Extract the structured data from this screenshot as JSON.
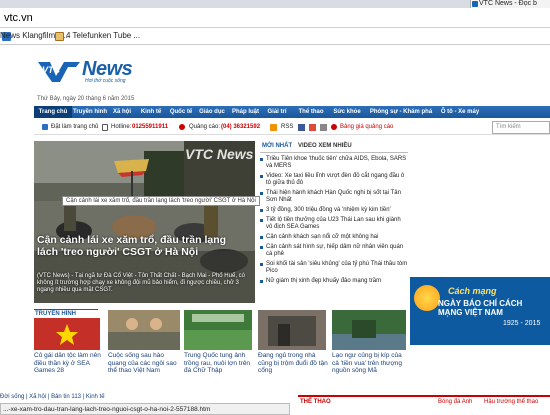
{
  "browser": {
    "tab_title": "VTC News - Đọc b",
    "url": "vtc.vn",
    "bookmarks": [
      {
        "label": "News Klangfilm T..."
      },
      {
        "label": "4 Telefunken Tube ..."
      }
    ]
  },
  "site": {
    "logo": "News",
    "logo_brand": "VTC",
    "tagline": "Hơi thở cuộc sống",
    "date": "Thứ Bảy, ngày 20 tháng 6 năm 2015"
  },
  "nav": {
    "items": [
      {
        "label": "Trang chủ",
        "active": true
      },
      {
        "label": "Truyền hình",
        "active": false
      },
      {
        "label": "Xã hội",
        "active": false
      },
      {
        "label": "Kinh tế",
        "active": false
      },
      {
        "label": "Quốc tế",
        "active": false
      },
      {
        "label": "Giáo dục",
        "active": false
      },
      {
        "label": "Pháp luật",
        "active": false
      },
      {
        "label": "Giải trí",
        "active": false
      },
      {
        "label": "Thể thao",
        "active": false
      },
      {
        "label": "Sức khỏe",
        "active": false
      },
      {
        "label": "Phóng sự - Khám phá",
        "active": false
      },
      {
        "label": "Ô tô - Xe máy",
        "active": false
      }
    ]
  },
  "infobar": {
    "fixed_label": "Đặt làm trang chủ",
    "hotline_label": "Hotline:",
    "hotline": "01255911911",
    "ads_label": "Quảng cáo:",
    "ads_phone": "(04) 36321592",
    "rss": "RSS",
    "price_link": "Bảng giá quảng cáo",
    "search_placeholder": "Tìm kiếm"
  },
  "hero": {
    "image_watermark": "VTC News",
    "tooltip": "Cận cảnh lái xe xăm trổ, đầu trần lạng lách 'treo người' CSGT ở Hà Nội",
    "title": "Cận cảnh lái xe xăm trổ, đầu trần lạng lách 'treo người' CSGT ở Hà Nội",
    "desc": "(VTC News) - Tại ngã tư Đà Cổ Việt - Tôn Thất Chất - Bạch Mai - Phố Huế, có không ít trường hợp chạy xe không đội mũ bảo hiểm, đi ngược chiều, chở 3 ngang nhiều qua mặt CSGT."
  },
  "news": {
    "tab_latest": "MỚI NHẤT",
    "tab_video": "VIDEO XEM NHIỀU",
    "items": [
      "Triều Tiên khoe 'thuốc tiên' chữa AIDS, Ebola, SARS và MERS",
      "Video: Xe taxi liều lĩnh vượt đèn đỏ cắt ngang đầu ô tô giữa thủ đô",
      "Thái hiện hành khách Hàn Quốc nghi bị sốt tại Tân Sơn Nhất",
      "3 tỷ đồng, 300 triệu đồng và 'nhiệm kỳ kim tiền'",
      "Tiết lộ tiền thưởng của U23 Thái Lan sau khi giành vô địch SEA Games",
      "Cận cảnh khách sạn nổi cỡ một không hai",
      "Cận cảnh sát hình sự, hiếp dâm nữ nhân viên quán cà phê",
      "Soi khối tài sản 'siêu khủng' của tỷ phú Thái thầu tòm Pico",
      "Nữ giám thị xinh đẹp khuấy đảo mạng trầm"
    ]
  },
  "ad": {
    "line1": "Cách mạng",
    "line2": "NGÀY BÁO CHÍ CÁCH MẠNG VIỆT NAM",
    "line3": "1925 - 2015"
  },
  "bottom": {
    "tv_label": "TRUYỀN HÌNH",
    "cards": [
      {
        "caption": "Cô gái dân tộc làm nên điều thần kỳ ở SEA Games 28"
      },
      {
        "caption": "Cuộc sống sau hào quang của các ngôi sao thể thao Việt Nam"
      },
      {
        "caption": "Trung Quốc tung ảnh trồng rau, nuôi lợn trên đá Chữ Thập"
      },
      {
        "caption": "Đang ngủ trong nhà cũng bị trộm đuổi đồ tận cổng"
      },
      {
        "caption": "Lạo ngư củng bị kíp của cả 'tiền vua' trên thượng nguồn sông Mã"
      }
    ],
    "links": "Đời sống | Xã hội | Bản tin 113 | Kinh tế"
  },
  "status": {
    "url": "...-xe-xam-tro-dau-tran-lang-lach-treo-nguoi-csgt-o-ha-noi-2-557188.htm"
  },
  "strip": {
    "sports": "THỂ THAO",
    "item1": "Bóng đá Anh",
    "item2": "Hậu trường thể thao"
  },
  "colors": {
    "brand_blue": "#1a579c",
    "accent_red": "#c00000"
  }
}
